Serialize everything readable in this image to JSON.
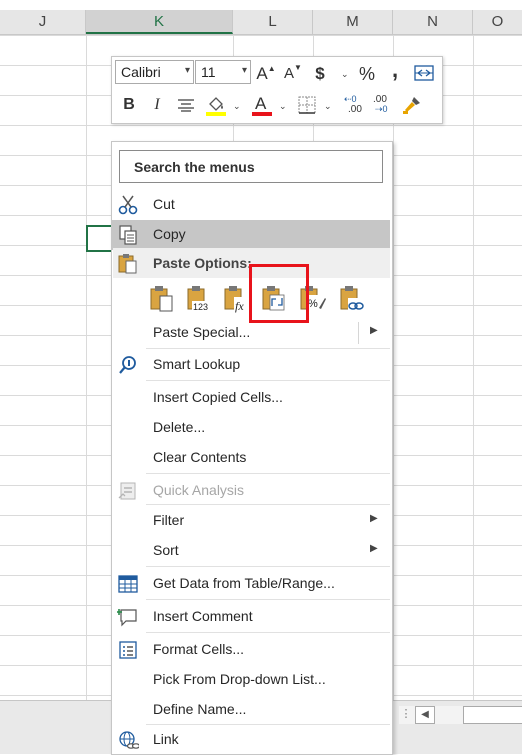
{
  "spreadsheet": {
    "columns": [
      {
        "label": "J",
        "selected": false
      },
      {
        "label": "K",
        "selected": true
      },
      {
        "label": "L",
        "selected": false
      },
      {
        "label": "M",
        "selected": false
      },
      {
        "label": "N",
        "selected": false
      },
      {
        "label": "O",
        "selected": false
      }
    ]
  },
  "mini_toolbar": {
    "font_name": "Calibri",
    "font_size": "11",
    "increase_font_label": "A",
    "decrease_font_label": "A",
    "currency_label": "$",
    "percent_label": "%",
    "comma_label": ",",
    "bold_label": "B",
    "italic_label": "I",
    "font_color_label": "A",
    "increase_decimal_label": ".00",
    "decrease_decimal_label": ".00",
    "font_color": "#e8131b",
    "fill_color": "#ffff00"
  },
  "context_menu": {
    "search_placeholder": "Search the menus",
    "items": {
      "cut": "Cut",
      "copy": "Copy",
      "paste_options": "Paste Options:",
      "paste_special": "Paste Special...",
      "smart_lookup": "Smart Lookup",
      "insert_copied_cells": "Insert Copied Cells...",
      "delete": "Delete...",
      "clear_contents": "Clear Contents",
      "quick_analysis": "Quick Analysis",
      "filter": "Filter",
      "sort": "Sort",
      "get_data": "Get Data from Table/Range...",
      "insert_comment": "Insert Comment",
      "format_cells": "Format Cells...",
      "pick_from_list": "Pick From Drop-down List...",
      "define_name": "Define Name...",
      "link": "Link"
    },
    "paste_icons": [
      {
        "icon": "paste-icon",
        "tag": ""
      },
      {
        "icon": "paste-values-icon",
        "tag": "123"
      },
      {
        "icon": "paste-formulas-icon",
        "tag": "fx"
      },
      {
        "icon": "paste-transpose-icon",
        "tag": ""
      },
      {
        "icon": "paste-formatting-icon",
        "tag": "%"
      },
      {
        "icon": "paste-link-icon",
        "tag": ""
      }
    ],
    "highlight_color": "#e8131b"
  }
}
